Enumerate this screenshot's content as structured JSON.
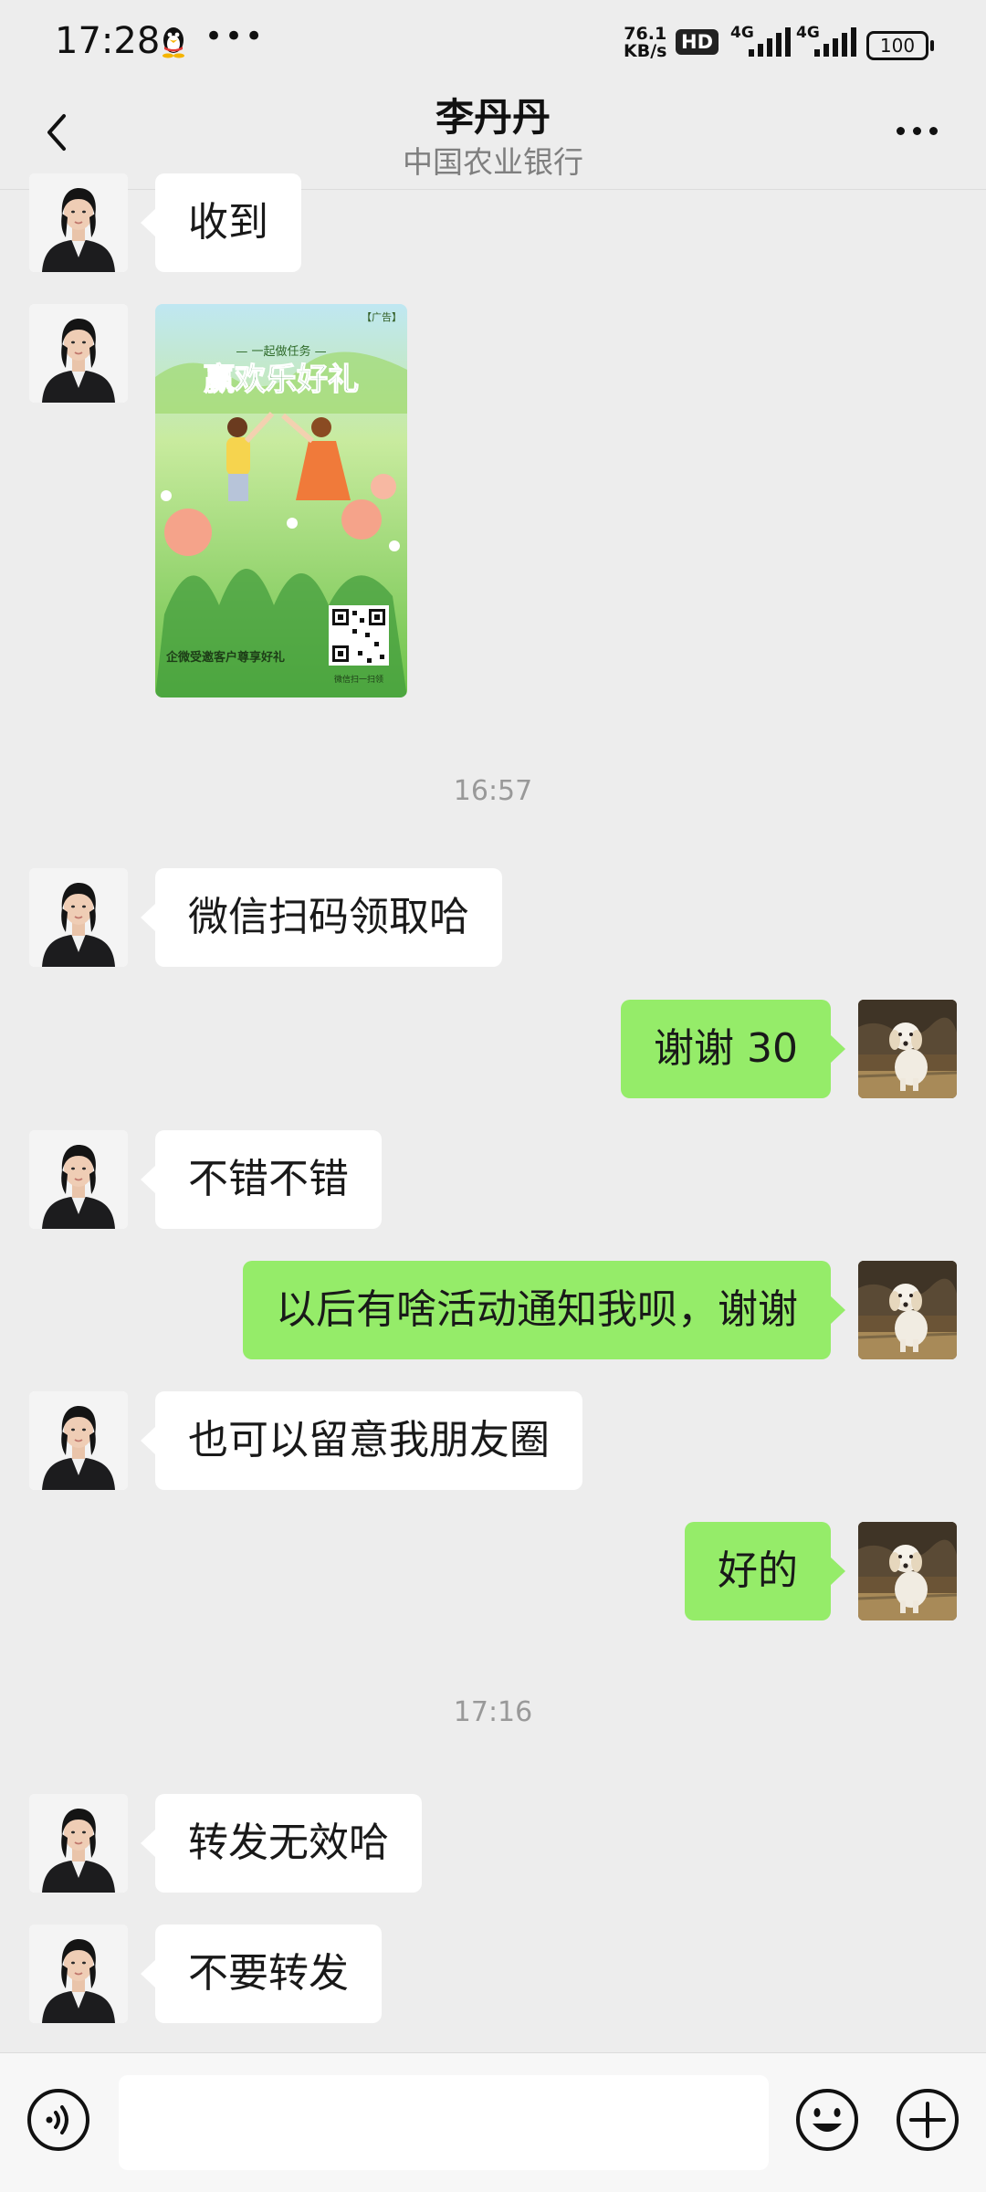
{
  "status_bar": {
    "time": "17:28",
    "network_speed_value": "76.1",
    "network_speed_unit": "KB/s",
    "hd_badge": "HD",
    "signal1_label": "4G",
    "signal2_label": "4G",
    "battery": "100",
    "icons": [
      "qq-penguin-icon",
      "more-notifications-icon"
    ]
  },
  "header": {
    "title": "李丹丹",
    "subtitle": "中国农业银行",
    "back_icon": "chevron-left-icon",
    "more_icon": "more-dots-icon"
  },
  "ad_card": {
    "tag": "【广告】",
    "kicker": "— 一起做任务 —",
    "headline": "赢欢乐好礼",
    "caption": "企微受邀客户尊享好礼",
    "qr_caption": "微信扫一扫领"
  },
  "messages": {
    "m1": "收到",
    "t1": "16:57",
    "m2": "微信扫码领取哈",
    "m3": "谢谢 30",
    "m4": "不错不错",
    "m5": "以后有啥活动通知我呗，谢谢",
    "m6": "也可以留意我朋友圈",
    "m7": "好的",
    "t2": "17:16",
    "m8": "转发无效哈",
    "m9": "不要转发"
  },
  "input_bar": {
    "value": "",
    "icons": [
      "voice-icon",
      "emoji-icon",
      "plus-icon"
    ]
  },
  "colors": {
    "background": "#ededed",
    "bubble_self": "#95ec69",
    "bubble_other": "#ffffff",
    "timestamp": "#999999"
  }
}
